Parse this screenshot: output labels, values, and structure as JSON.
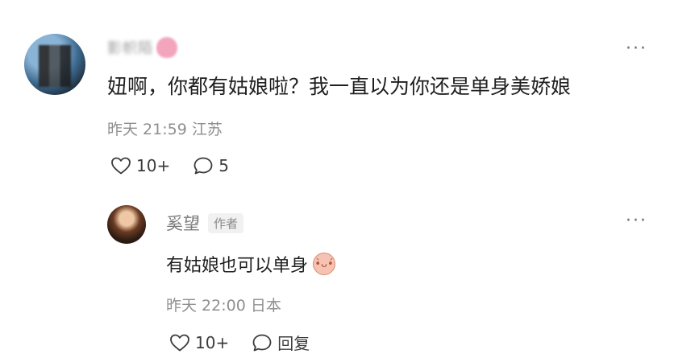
{
  "comment": {
    "username_blurred": "影帜陌",
    "text": "妞啊，你都有姑娘啦？我一直以为你还是单身美娇娘",
    "time": "昨天 21:59",
    "location": "江苏",
    "likes": "10+",
    "replies_count": "5",
    "more_label": "···"
  },
  "reply": {
    "username": "奚望",
    "badge": "作者",
    "text": "有姑娘也可以单身",
    "emoji_label": "🐷",
    "time": "昨天 22:00",
    "location": "日本",
    "likes": "10+",
    "reply_label": "回复",
    "more_label": "···"
  }
}
